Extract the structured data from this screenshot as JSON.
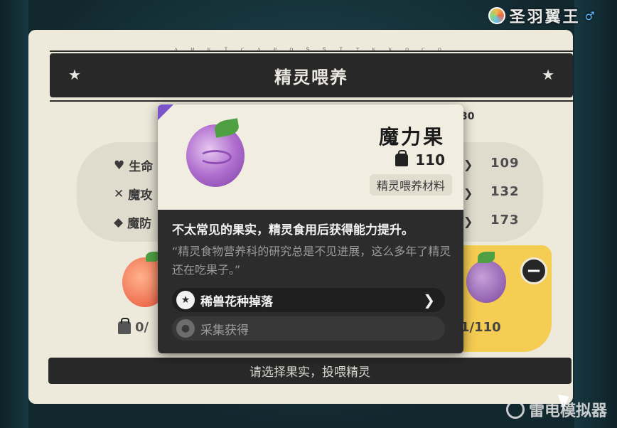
{
  "player": {
    "name": "圣羽翼王",
    "gender_icon": "male-icon"
  },
  "panel": {
    "title": "精灵喂养",
    "runes": "ᴧ ᴎ ᴋ ɪ ᴄ ᴧ ᴘ ᴏ ꜱ ꜱ ɪ ᴛ ᴋ ᴋ ᴏ ᴄ ᴏ ᴍ ᴏ",
    "feed_prompt": "请选择果实，投喂精灵",
    "hidden_level": "30",
    "stats": [
      {
        "label": "生命",
        "icon": "heart-icon",
        "value": "109"
      },
      {
        "label": "魔攻",
        "icon": "sword-icon",
        "value": "132"
      },
      {
        "label": "魔防",
        "icon": "shield-icon",
        "value": "173"
      }
    ],
    "left_slot": {
      "count": "0/"
    },
    "right_slot": {
      "count": "1/110"
    }
  },
  "popup": {
    "item_name": "魔力果",
    "quantity": "110",
    "category": "精灵喂养材料",
    "description": "不太常见的果实，精灵食用后获得能力提升。",
    "quote": "“精灵食物营养科的研究总是不见进展，这么多年了精灵还在吃果子。”",
    "sources": [
      {
        "label": "稀兽花种掉落",
        "active": true
      },
      {
        "label": "采集获得",
        "active": false
      }
    ]
  },
  "watermark": "雷电模拟器",
  "colors": {
    "accent_purple": "#7a54c8",
    "slot_yellow": "#f5cd52",
    "panel_bg": "#eeeadb"
  }
}
